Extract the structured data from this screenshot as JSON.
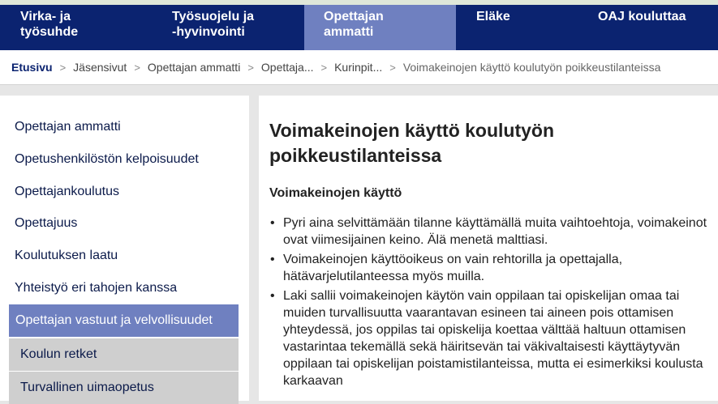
{
  "topnav": {
    "items": [
      {
        "label": "Virka- ja\ntyösuhde"
      },
      {
        "label": "Työsuojelu ja\n-hyvinvointi"
      },
      {
        "label": "Opettajan\nammatti"
      },
      {
        "label": "Eläke"
      },
      {
        "label": "OAJ kouluttaa"
      }
    ],
    "active_color": "#6f80c0",
    "background_color": "#0b2370"
  },
  "breadcrumb": {
    "separator": ">",
    "items": [
      "Etusivu",
      "Jäsensivut",
      "Opettajan ammatti",
      "Opettaja...",
      "Kurinpit...",
      "Voimakeinojen käyttö koulutyön poikkeustilanteissa"
    ]
  },
  "sidebar": {
    "items": [
      "Opettajan ammatti",
      "Opetushenkilöstön kelpoisuudet",
      "Opettajankoulutus",
      "Opettajuus",
      "Koulutuksen laatu",
      "Yhteistyö eri tahojen kanssa"
    ],
    "active_item": "Opettajan vastuut ja velvollisuudet",
    "sub_items": [
      "Koulun retket",
      "Turvallinen uimaopetus"
    ]
  },
  "main": {
    "title": "Voimakeinojen käyttö koulutyön poikkeustilanteissa",
    "section_heading": "Voimakeinojen käyttö",
    "bullet_symbol": "•",
    "bullets": [
      "Pyri aina selvittämään tilanne käyttämällä muita vaihtoehtoja, voimakeinot ovat viimesijainen keino. Älä menetä malttiasi.",
      "Voimakeinojen käyttöoikeus on vain rehtorilla ja opettajalla, hätävarjelutilanteessa myös muilla.",
      "Laki sallii voimakeinojen käytön vain oppilaan tai opiskelijan omaa tai muiden turvallisuutta vaarantavan esineen tai aineen pois ottamisen yhteydessä, jos oppilas tai opiskelija koettaa välttää haltuun ottamisen vastarintaa tekemällä sekä häiritsevän tai väkivaltaisesti käyttäytyvän oppilaan tai opiskelijan poistamistilanteissa, mutta ei esimerkiksi koulusta karkaavan"
    ]
  }
}
